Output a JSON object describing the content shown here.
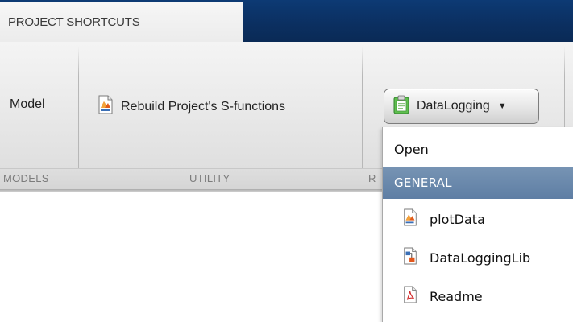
{
  "tabs": {
    "active_label": "PROJECT SHORTCUTS"
  },
  "sections": {
    "models": {
      "button_label": "Model",
      "footer_label": "MODELS"
    },
    "utility": {
      "button_label": "Rebuild Project's S-functions",
      "button_icon": "m-file-icon",
      "footer_label": "UTILITY"
    },
    "third": {
      "footer_label_visible": "R",
      "split_button_label": "DataLogging",
      "split_button_icon": "clipboard-icon",
      "accent": "#3da33d"
    }
  },
  "menu": {
    "open_label": "Open",
    "group_header": "GENERAL",
    "header_color": "#6888ac",
    "items": [
      {
        "label": "plotData",
        "icon": "m-file-icon"
      },
      {
        "label": "DataLoggingLib",
        "icon": "simulink-model-icon"
      },
      {
        "label": "Readme",
        "icon": "pdf-file-icon"
      }
    ]
  }
}
